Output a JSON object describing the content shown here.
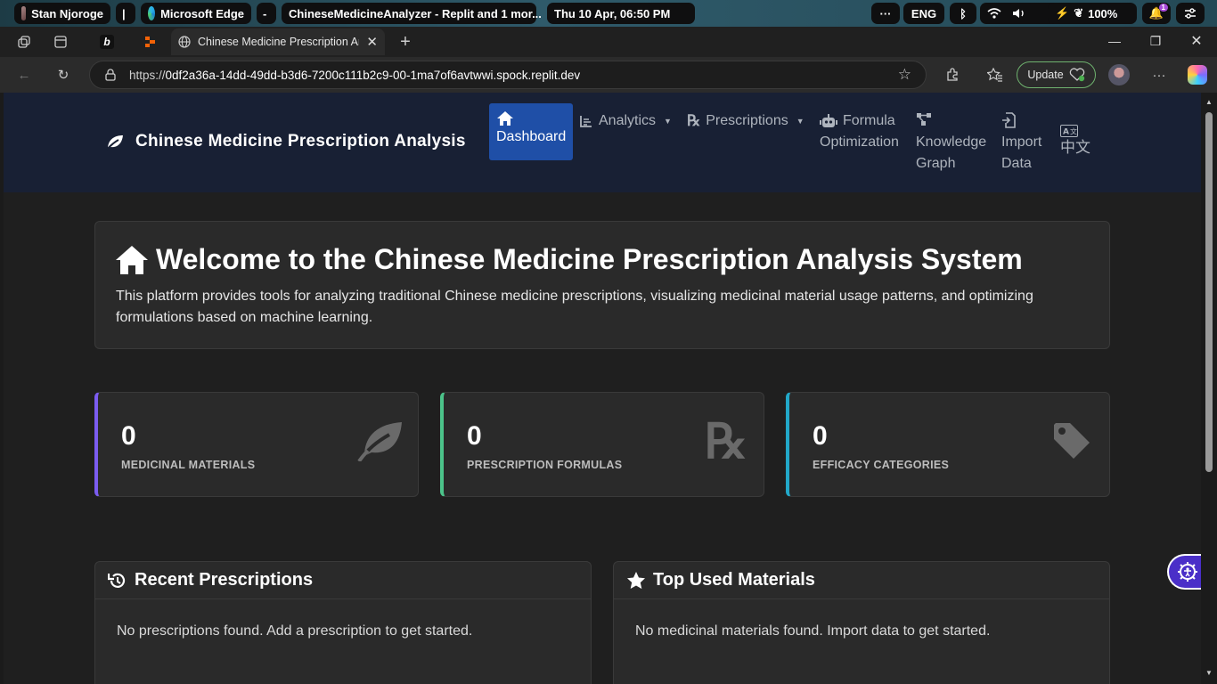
{
  "taskbar": {
    "user": "Stan Njoroge",
    "separator": "|",
    "app": "Microsoft Edge",
    "dash": "-",
    "window_title": "ChineseMedicineAnalyzer - Replit and 1 mor...",
    "datetime": "Thu 10 Apr, 06:50 PM",
    "more": "···",
    "lang": "ENG",
    "battery": "100%",
    "notif_count": "1"
  },
  "browser": {
    "tab_title": "Chinese Medicine Prescription An",
    "url_prefix": "https://",
    "url_host": "0df2a36a-14dd-49dd-b3d6-7200c111b2c9-00-1ma7of6avtwwi.spock.replit.dev",
    "update_label": "Update"
  },
  "nav": {
    "brand": "Chinese Medicine Prescription Analysis",
    "items": [
      {
        "line1": "Dashboard"
      },
      {
        "line1": "Analytics"
      },
      {
        "line1": "Prescriptions"
      },
      {
        "line1": "Formula",
        "line2": "Optimization"
      },
      {
        "line1": "Knowledge",
        "line2": "Graph"
      },
      {
        "line1": "Import",
        "line2": "Data"
      },
      {
        "line1": "中文"
      }
    ]
  },
  "welcome": {
    "title": "Welcome to the Chinese Medicine Prescription Analysis System",
    "text": "This platform provides tools for analyzing traditional Chinese medicine prescriptions, visualizing medicinal material usage patterns, and optimizing formulations based on machine learning."
  },
  "stats": [
    {
      "value": "0",
      "label": "MEDICINAL MATERIALS",
      "color": "#7b5cf0",
      "icon": "leaf-icon"
    },
    {
      "value": "0",
      "label": "PRESCRIPTION FORMULAS",
      "color": "#4cc38a",
      "icon": "prescription-icon"
    },
    {
      "value": "0",
      "label": "EFFICACY CATEGORIES",
      "color": "#22a8c9",
      "icon": "tag-icon"
    }
  ],
  "panels": {
    "recent": {
      "title": "Recent Prescriptions",
      "empty": "No prescriptions found. Add a prescription to get started."
    },
    "top": {
      "title": "Top Used Materials",
      "empty": "No medicinal materials found. Import data to get started."
    }
  }
}
